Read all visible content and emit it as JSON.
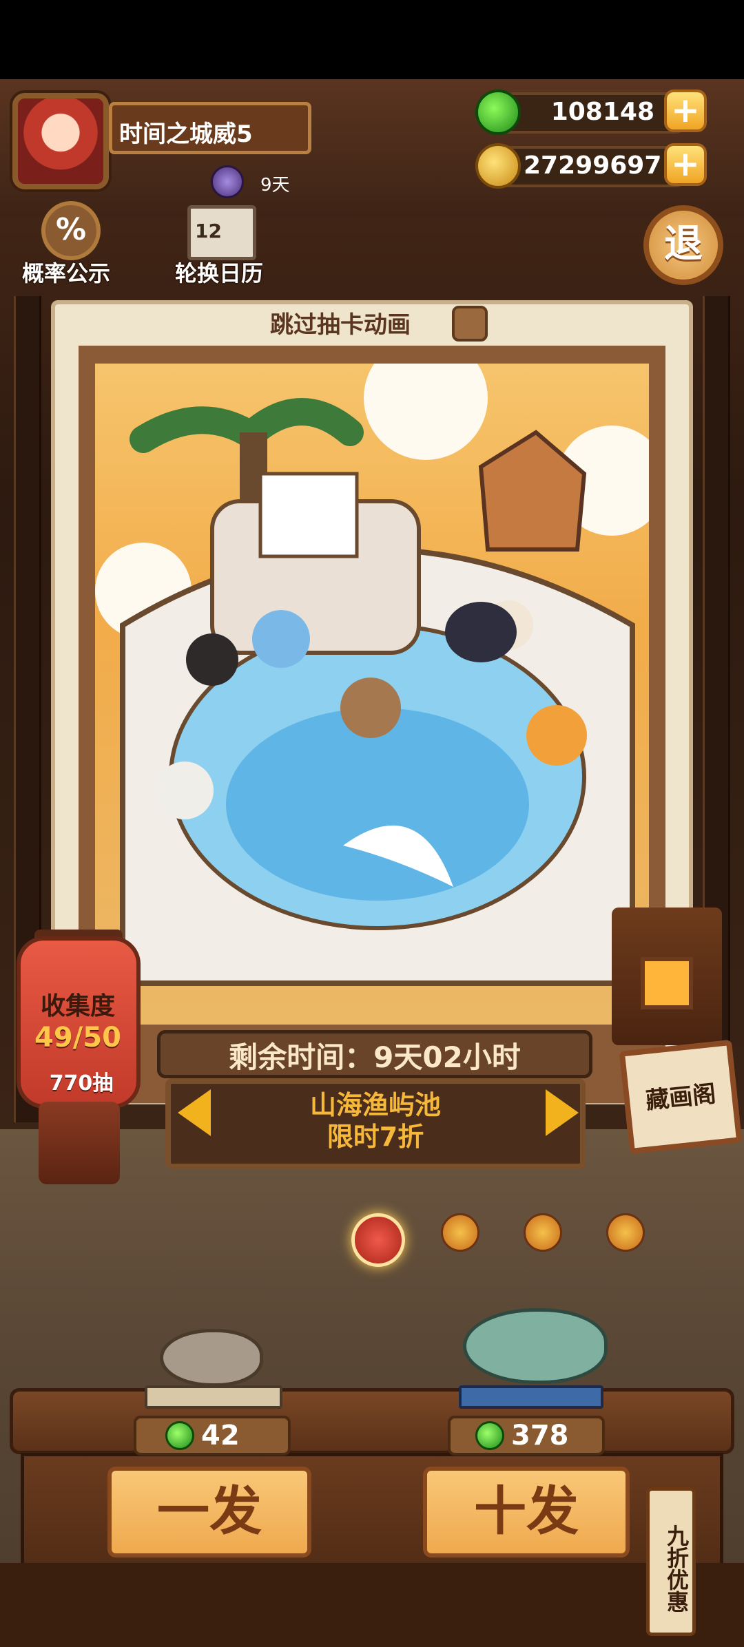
{
  "player": {
    "name": "时间之城威5",
    "days": "9天"
  },
  "currency": [
    {
      "icon": "jade-coin-icon",
      "value": "108148"
    },
    {
      "icon": "gold-coin-icon",
      "value": "27299697"
    }
  ],
  "tools": {
    "probability_label": "概率公示",
    "calendar_label": "轮换日历",
    "calendar_glyph": "12"
  },
  "exit_label": "退",
  "skip_animation_label": "跳过抽卡动画",
  "collection": {
    "title": "收集度",
    "count": "49/50",
    "draws": "770抽"
  },
  "banner": {
    "timer": "剩余时间：9天02小时",
    "pool_name": "山海渔屿池",
    "pool_discount": "限时7折"
  },
  "gallery_label": "藏画阁",
  "pages": {
    "total": 4,
    "active": 1
  },
  "draw": {
    "single": {
      "label": "一发",
      "cost": "42"
    },
    "ten": {
      "label": "十发",
      "cost": "378"
    },
    "discount_tag": "九折优惠"
  },
  "colors": {
    "accent": "#f2b21e",
    "jade": "#2fbf24",
    "panel": "#6a4428"
  }
}
